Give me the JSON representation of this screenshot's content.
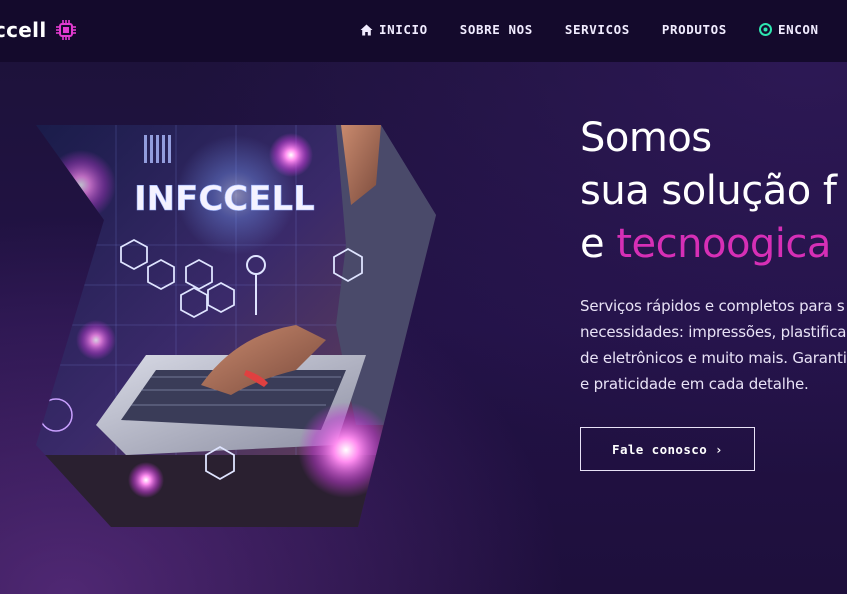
{
  "brand": {
    "name": "ccell",
    "logo_icon": "chip-icon"
  },
  "nav": {
    "items": [
      {
        "label": "INICIO",
        "icon": "home-icon"
      },
      {
        "label": "SOBRE NOS"
      },
      {
        "label": "SERVICOS"
      },
      {
        "label": "PRODUTOS"
      },
      {
        "label": "ENCON",
        "icon": "location-icon"
      }
    ]
  },
  "hero": {
    "image_text": "INFCCELL",
    "title_line1": "Somos",
    "title_line2": "sua solução f",
    "title_line3_prefix": "e ",
    "title_line3_accent": "tecnoogica",
    "description_lines": [
      "Serviços rápidos e completos para s",
      "necessidades: impressões, plastifica",
      "de eletrônicos e muito mais. Garantin",
      "e praticidade em cada detalhe."
    ],
    "cta_label": "Fale conosco ›"
  },
  "colors": {
    "background": "#1a0d33",
    "navbar": "#140a2c",
    "accent": "#d62fb6",
    "text": "#ffffff",
    "icon_teal": "#2ee6b0"
  }
}
